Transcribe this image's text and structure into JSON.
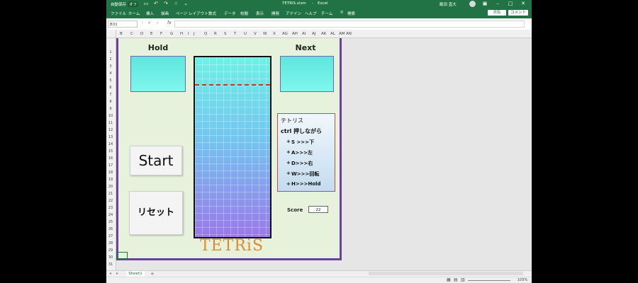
{
  "titlebar": {
    "autosave": "自動保存",
    "autosave_state": "オフ",
    "filename": "TETRiS.xlsm",
    "app": "Excel",
    "user": "飯田 直大"
  },
  "menu": {
    "items": [
      "ファイル",
      "ホーム",
      "挿入",
      "描画",
      "ページ レイアウト",
      "数式",
      "データ",
      "校閲",
      "表示",
      "開発",
      "ヘルプ",
      "チーム"
    ],
    "search": "検索",
    "share": "共有",
    "comment": "コメント"
  },
  "formula_bar": {
    "namebox": "B31",
    "fx": "fx",
    "value": ""
  },
  "columns": [
    "B",
    "C",
    "D",
    "E",
    "F",
    "G",
    "H",
    "I",
    "J",
    "Q",
    "R",
    "S",
    "T",
    "U",
    "V",
    "W",
    "X",
    "AG",
    "AH",
    "AI",
    "AJ",
    "AK",
    "AL",
    "AM",
    "AN"
  ],
  "rows": [
    "1",
    "2",
    "3",
    "4",
    "5",
    "6",
    "7",
    "8",
    "9",
    "10",
    "11",
    "12",
    "13",
    "14",
    "15",
    "16",
    "17",
    "18",
    "19",
    "20",
    "21",
    "22",
    "23",
    "24",
    "25",
    "26",
    "27",
    "28",
    "29",
    "30",
    "31"
  ],
  "game": {
    "hold_label": "Hold",
    "next_label": "Next",
    "start_label": "Start",
    "reset_label": "リセット",
    "help_title": "テトリス",
    "help_sub": "ctrl 押しながら",
    "help_lines": [
      "S >>>下",
      "A>>>左",
      "D>>>右",
      "W>>>回転",
      "H>>>Hold"
    ],
    "score_label": "Score",
    "score_value": "22",
    "logo": "TETRiS"
  },
  "sheet_tabs": {
    "active": "Sheet1",
    "add": "+"
  },
  "status": {
    "zoom": "105%"
  }
}
